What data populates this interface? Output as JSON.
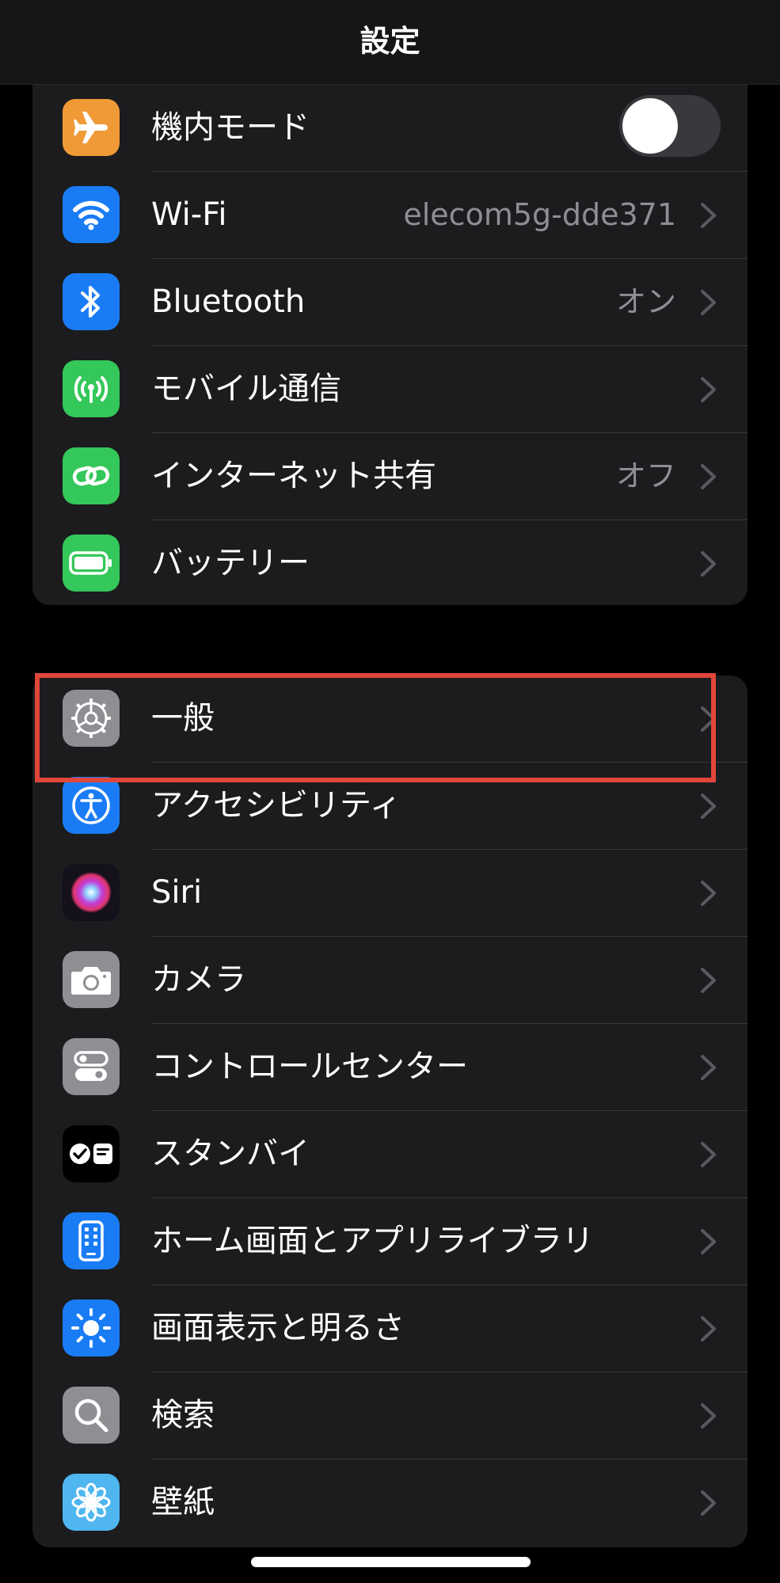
{
  "nav": {
    "title": "設定"
  },
  "colors": {
    "accent_highlight": "#e0463a",
    "orange": "#f09a37",
    "blue": "#1a7cf5",
    "green": "#34c759",
    "gray": "#8e8e93",
    "black_tile": "#000000",
    "sky": "#4fb6f0"
  },
  "group1": {
    "items": [
      {
        "label": "機内モード",
        "icon": "airplane-icon",
        "toggle": "off"
      },
      {
        "label": "Wi-Fi",
        "value": "elecom5g-dde371",
        "icon": "wifi-icon"
      },
      {
        "label": "Bluetooth",
        "value": "オン",
        "icon": "bluetooth-icon"
      },
      {
        "label": "モバイル通信",
        "icon": "antenna-icon"
      },
      {
        "label": "インターネット共有",
        "value": "オフ",
        "icon": "link-icon"
      },
      {
        "label": "バッテリー",
        "icon": "battery-icon"
      }
    ]
  },
  "group2": {
    "items": [
      {
        "label": "一般",
        "icon": "gear-icon"
      },
      {
        "label": "アクセシビリティ",
        "icon": "accessibility-icon"
      },
      {
        "label": "Siri",
        "icon": "siri-icon"
      },
      {
        "label": "カメラ",
        "icon": "camera-icon"
      },
      {
        "label": "コントロールセンター",
        "icon": "switches-icon"
      },
      {
        "label": "スタンバイ",
        "icon": "standby-icon"
      },
      {
        "label": "ホーム画面とアプリライブラリ",
        "icon": "phone-grid-icon"
      },
      {
        "label": "画面表示と明るさ",
        "icon": "sun-icon"
      },
      {
        "label": "検索",
        "icon": "magnifier-icon"
      },
      {
        "label": "壁紙",
        "icon": "flower-icon"
      }
    ]
  }
}
